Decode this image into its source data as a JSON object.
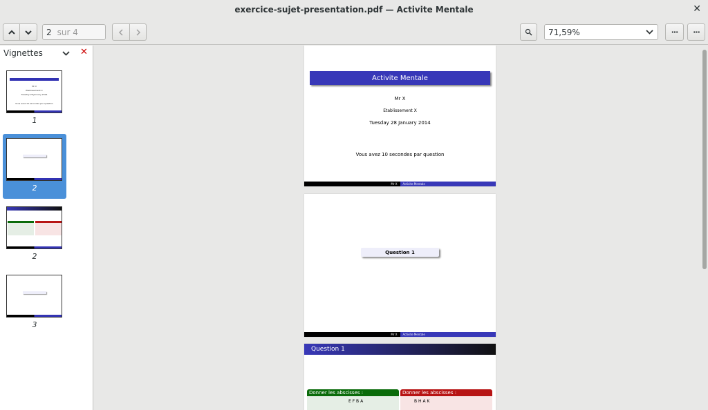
{
  "window": {
    "title": "exercice-sujet-presentation.pdf — Activite Mentale"
  },
  "toolbar": {
    "page_current": "2",
    "page_total": "sur 4",
    "zoom_value": "71,59%"
  },
  "sidebar": {
    "header": "Vignettes",
    "thumbnails": [
      {
        "label": "1",
        "selected": false
      },
      {
        "label": "2",
        "selected": true
      },
      {
        "label": "2",
        "selected": false
      },
      {
        "label": "3",
        "selected": false
      }
    ]
  },
  "pages": {
    "p1": {
      "title": "Activite Mentale",
      "author": "Mr X",
      "institution": "Etablissement X",
      "date": "Tuesday 28 January 2014",
      "note": "Vous avez 10 secondes par question",
      "footer_left": "Mr X",
      "footer_right": "Activite Mentale"
    },
    "p2": {
      "question": "Question 1",
      "footer_left": "Mr X",
      "footer_right": "Activite Mentale"
    },
    "p3": {
      "frame_title": "Question 1",
      "block_left_title": "Donner les abscisses :",
      "block_left_body": "E    F    B    A",
      "block_right_title": "Donner les abscisses :",
      "block_right_body": "B              H    A     K"
    }
  }
}
